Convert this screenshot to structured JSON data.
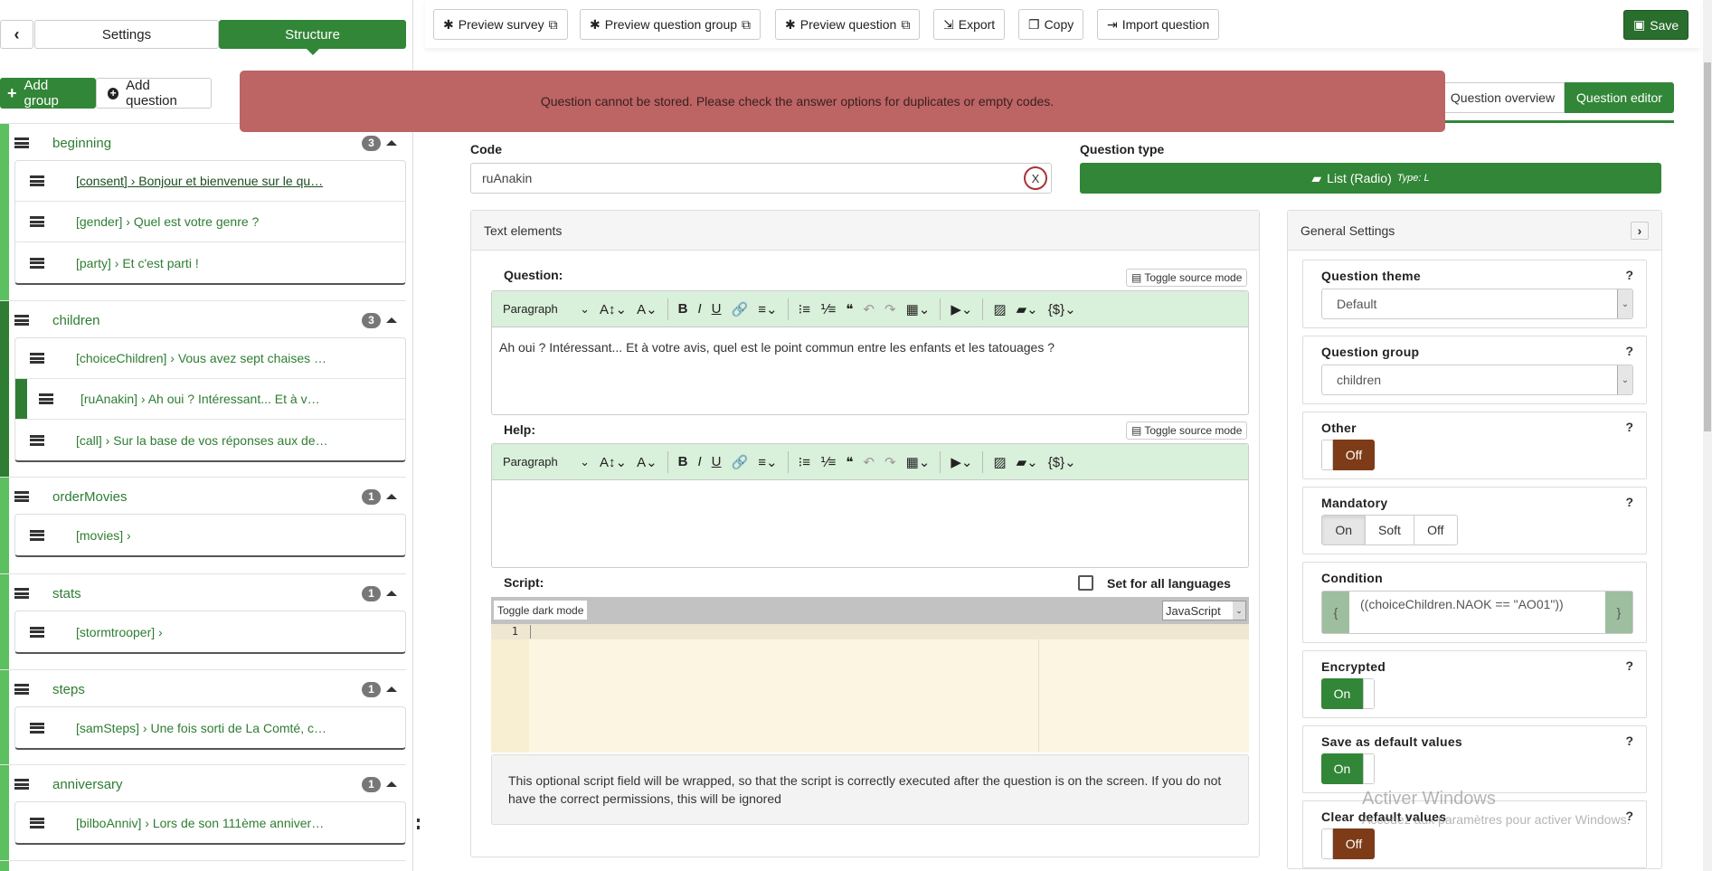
{
  "sidebar": {
    "tabs": {
      "settings": "Settings",
      "structure": "Structure"
    },
    "add_group": "Add group",
    "add_question": "Add question",
    "groups": [
      {
        "name": "beginning",
        "count": "3",
        "items": [
          "[consent] › Bonjour et bienvenue sur le qu…",
          "[gender] › Quel est votre genre ?",
          "[party] › Et c'est parti !"
        ]
      },
      {
        "name": "children",
        "count": "3",
        "items": [
          "[choiceChildren] › Vous avez sept chaises …",
          "[ruAnakin] › Ah oui ? Intéressant... Et à v…",
          "[call] › Sur la base de vos réponses aux de…"
        ]
      },
      {
        "name": "orderMovies",
        "count": "1",
        "items": [
          "[movies] ›"
        ]
      },
      {
        "name": "stats",
        "count": "1",
        "items": [
          "[stormtrooper] ›"
        ]
      },
      {
        "name": "steps",
        "count": "1",
        "items": [
          "[samSteps] › Une fois sorti de La Comté, c…"
        ]
      },
      {
        "name": "anniversary",
        "count": "1",
        "items": [
          "[bilboAnniv] › Lors de son 111ème anniver…"
        ]
      }
    ]
  },
  "toolbar": {
    "preview_survey": "Preview survey",
    "preview_group": "Preview question group",
    "preview_question": "Preview question",
    "export": "Export",
    "copy": "Copy",
    "import": "Import question",
    "save": "Save"
  },
  "alert": {
    "message": "Question cannot be stored. Please check the answer options for duplicates or empty codes."
  },
  "view_tabs": {
    "overview": "Question overview",
    "editor": "Question editor"
  },
  "code": {
    "label": "Code",
    "value": "ruAnakin",
    "clear": "X"
  },
  "qtype": {
    "label": "Question type",
    "value": "List (Radio)",
    "type": "Type: L"
  },
  "text_elements": {
    "title": "Text elements",
    "question_label": "Question:",
    "help_label": "Help:",
    "toggle_source": "Toggle source mode",
    "paragraph": "Paragraph",
    "question_text": "Ah oui ? Intéressant... Et à votre avis, quel est le point commun entre les enfants et les tatouages ?",
    "help_text": "",
    "script_label": "Script:",
    "set_all_languages": "Set for all languages",
    "toggle_dark": "Toggle dark mode",
    "language": "JavaScript",
    "line_number": "1",
    "script_note": "This optional script field will be wrapped, so that the script is correctly executed after the question is on the screen. If you do not have the correct permissions, this will be ignored"
  },
  "general_settings": {
    "title": "General Settings",
    "question_theme": {
      "label": "Question theme",
      "value": "Default"
    },
    "question_group": {
      "label": "Question group",
      "value": "children"
    },
    "other": {
      "label": "Other",
      "value": "Off"
    },
    "mandatory": {
      "label": "Mandatory",
      "options": [
        "On",
        "Soft",
        "Off"
      ],
      "selected": "On"
    },
    "condition": {
      "label": "Condition",
      "value": "((choiceChildren.NAOK == \"AO01\"))",
      "open": "{",
      "close": "}"
    },
    "encrypted": {
      "label": "Encrypted",
      "value": "On"
    },
    "save_default": {
      "label": "Save as default values",
      "value": "On"
    },
    "clear_default": {
      "label": "Clear default values",
      "value": "Off"
    },
    "help": "?"
  },
  "watermark": {
    "line1": "Activer Windows",
    "line2": "Accédez aux paramètres pour activer Windows."
  },
  "colors": {
    "green": "#328637",
    "alert": "#bd6464",
    "off": "#7d3b17"
  }
}
